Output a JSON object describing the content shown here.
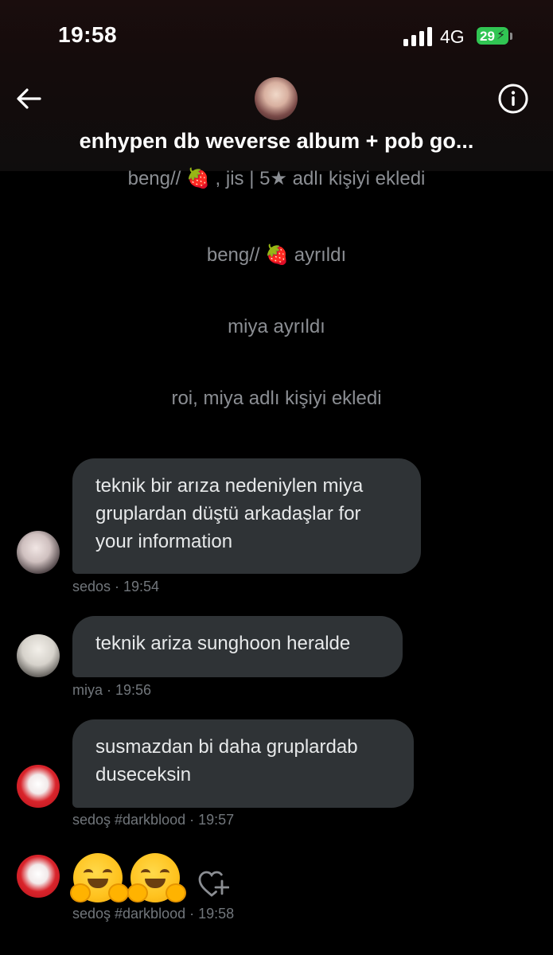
{
  "status_bar": {
    "time": "19:58",
    "network": "4G",
    "battery": "29"
  },
  "header": {
    "title": "enhypen db weverse album + pob go...",
    "back_icon": "arrow-left-icon",
    "info_icon": "info-icon"
  },
  "system_messages": [
    "beng// 🍓 , jis | 5★ adlı kişiyi ekledi",
    "beng// 🍓 ayrıldı",
    "miya ayrıldı",
    "roi, miya adlı kişiyi ekledi"
  ],
  "messages": [
    {
      "text_lines": [
        "teknik bir arıza nedeniylen miya",
        "gruplardan düştü arkadaşlar for",
        "your information"
      ],
      "meta": "sedos · 19:54"
    },
    {
      "text_lines": [
        "teknik ariza sunghoon heralde"
      ],
      "meta": "miya · 19:56"
    },
    {
      "text_lines": [
        "susmazdan bi daha gruplardab",
        "duseceksin"
      ],
      "meta": "sedoş #darkblood · 19:57"
    },
    {
      "emoji": "🤗🤗",
      "meta": "sedoş #darkblood · 19:58"
    }
  ],
  "colors": {
    "background": "#000000",
    "bubble": "#2f3336",
    "system_text": "#8b8e93",
    "meta_text": "#71767b",
    "battery": "#31c553"
  }
}
